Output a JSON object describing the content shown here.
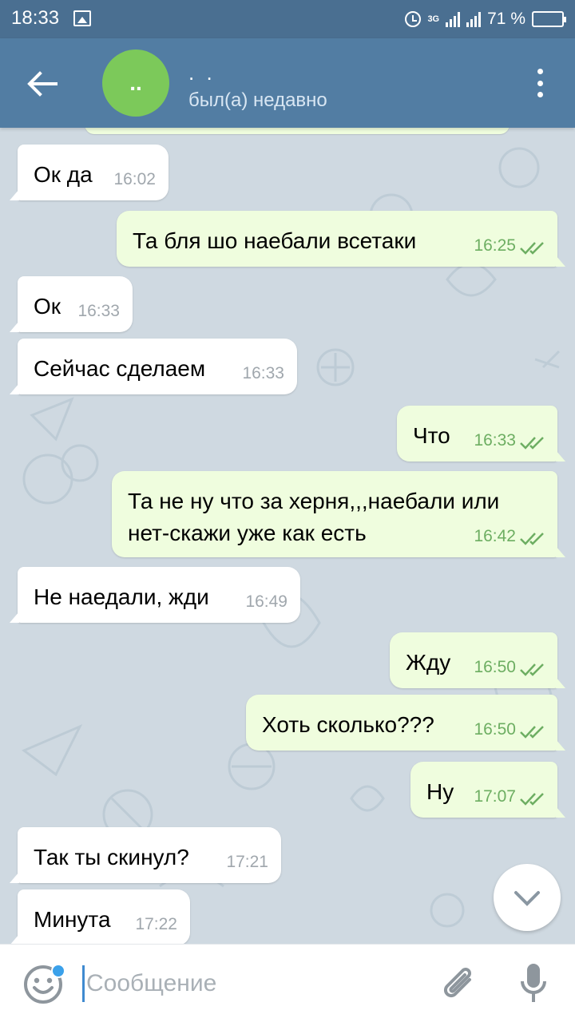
{
  "status_bar": {
    "time": "18:33",
    "network": "3G",
    "battery_percent": "71 %",
    "battery_level": 0.71
  },
  "header": {
    "avatar_initials": "..",
    "contact_name": ". .",
    "contact_status": "был(а) недавно",
    "back_icon": "arrow-left-icon",
    "menu_icon": "more-vertical-icon"
  },
  "colors": {
    "header": "#527da3",
    "status_bar": "#4a6f91",
    "avatar": "#7cc95a",
    "incoming_bubble": "#ffffff",
    "outgoing_bubble": "#effdde",
    "read_check": "#6dae62"
  },
  "messages": [
    {
      "dir": "in",
      "text": "Ок да",
      "time": "16:02"
    },
    {
      "dir": "out",
      "text": "Та бля шо наебали всетаки",
      "time": "16:25",
      "read": true
    },
    {
      "dir": "in",
      "text": "Ок",
      "time": "16:33"
    },
    {
      "dir": "in",
      "text": "Сейчас сделаем",
      "time": "16:33"
    },
    {
      "dir": "out",
      "text": "Что",
      "time": "16:33",
      "read": true
    },
    {
      "dir": "out",
      "text": "Та не ну что за херня,,,наебали или\nнет-скажи уже как есть",
      "time": "16:42",
      "read": true
    },
    {
      "dir": "in",
      "text": "Не наедали, жди",
      "time": "16:49"
    },
    {
      "dir": "out",
      "text": "Жду",
      "time": "16:50",
      "read": true
    },
    {
      "dir": "out",
      "text": "Хоть сколько???",
      "time": "16:50",
      "read": true
    },
    {
      "dir": "out",
      "text": "Ну",
      "time": "17:07",
      "read": true
    },
    {
      "dir": "in",
      "text": "Так ты скинул?",
      "time": "17:21"
    },
    {
      "dir": "in",
      "text": "Минута",
      "time": "17:22"
    }
  ],
  "input": {
    "placeholder": "Сообщение",
    "value": ""
  }
}
